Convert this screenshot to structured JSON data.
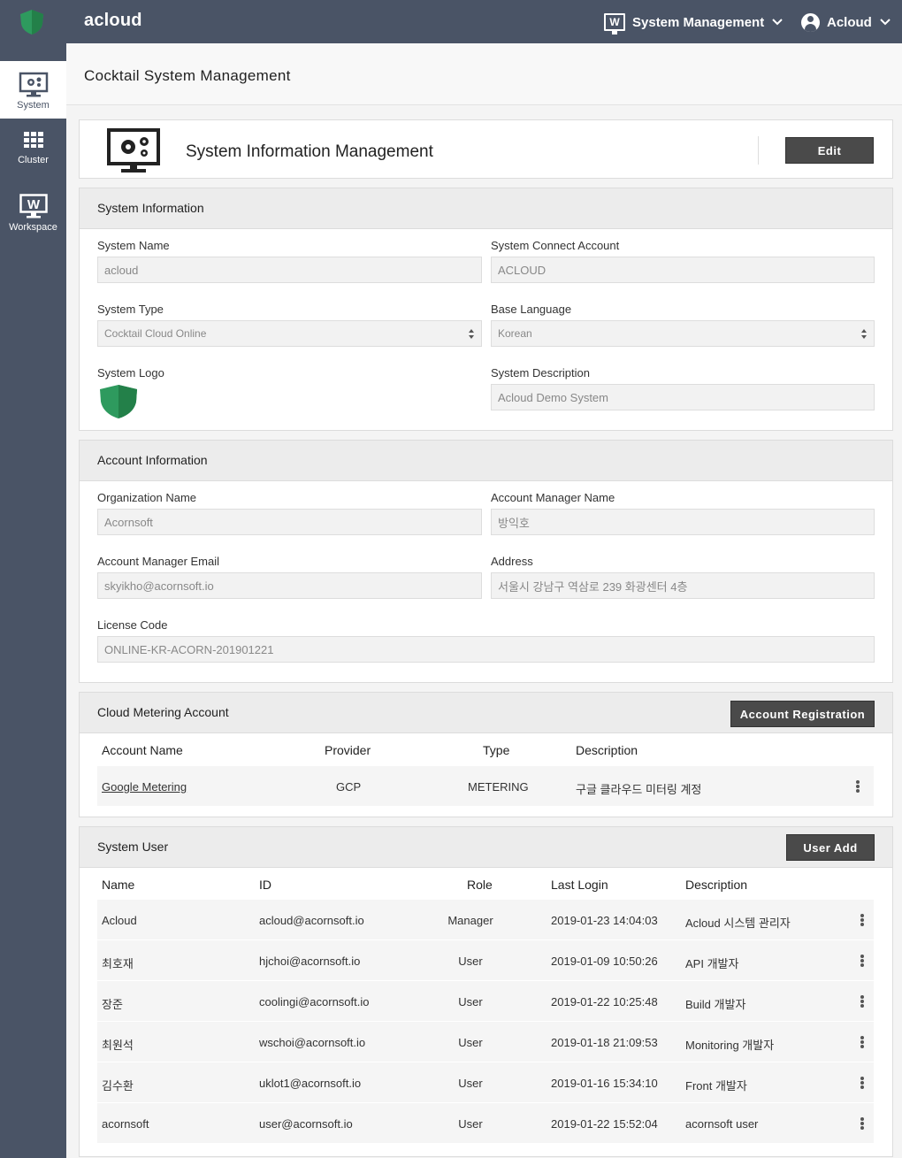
{
  "header": {
    "brand": "acloud",
    "system_menu": "System Management",
    "user_menu": "Acloud",
    "system_menu_icon": "workspace-w-icon",
    "brand_color": "#2e9a5e"
  },
  "sidebar": {
    "items": [
      {
        "label": "System",
        "icon": "monitor-gear-icon",
        "active": true
      },
      {
        "label": "Cluster",
        "icon": "grid-icon",
        "active": false
      },
      {
        "label": "Workspace",
        "icon": "workspace-w-icon",
        "active": false
      }
    ]
  },
  "page": {
    "title": "Cocktail System Management"
  },
  "info_card": {
    "title": "System Information Management",
    "edit_label": "Edit"
  },
  "system_info": {
    "title": "System Information",
    "system_name_label": "System Name",
    "system_name": "acloud",
    "connect_account_label": "System Connect Account",
    "connect_account": "ACLOUD",
    "system_type_label": "System Type",
    "system_type": "Cocktail Cloud Online",
    "base_language_label": "Base Language",
    "base_language": "Korean",
    "logo_label": "System Logo",
    "description_label": "System Description",
    "description": "Acloud Demo System"
  },
  "account_info": {
    "title": "Account Information",
    "org_label": "Organization Name",
    "org": "Acornsoft",
    "manager_label": "Account Manager Name",
    "manager": "방익호",
    "email_label": "Account Manager Email",
    "email": "skyikho@acornsoft.io",
    "address_label": "Address",
    "address": "서울시 강남구 역삼로 239 화광센터 4층",
    "license_label": "License Code",
    "license": "ONLINE-KR-ACORN-201901221"
  },
  "metering": {
    "title": "Cloud Metering Account",
    "register_label": "Account Registration",
    "columns": [
      "Account Name",
      "Provider",
      "Type",
      "Description"
    ],
    "rows": [
      {
        "name": "Google Metering",
        "provider": "GCP",
        "type": "METERING",
        "description": "구글 클라우드 미터링 계정"
      }
    ]
  },
  "users": {
    "title": "System User",
    "add_label": "User Add",
    "columns": [
      "Name",
      "ID",
      "Role",
      "Last Login",
      "Description"
    ],
    "rows": [
      {
        "name": "Acloud",
        "id": "acloud@acornsoft.io",
        "role": "Manager",
        "last_login": "2019-01-23 14:04:03",
        "description": "Acloud 시스템 관리자"
      },
      {
        "name": "최호재",
        "id": "hjchoi@acornsoft.io",
        "role": "User",
        "last_login": "2019-01-09 10:50:26",
        "description": "API 개발자"
      },
      {
        "name": "장준",
        "id": "coolingi@acornsoft.io",
        "role": "User",
        "last_login": "2019-01-22 10:25:48",
        "description": "Build 개발자"
      },
      {
        "name": "최원석",
        "id": "wschoi@acornsoft.io",
        "role": "User",
        "last_login": "2019-01-18 21:09:53",
        "description": "Monitoring 개발자"
      },
      {
        "name": "김수환",
        "id": "uklot1@acornsoft.io",
        "role": "User",
        "last_login": "2019-01-16 15:34:10",
        "description": "Front 개발자"
      },
      {
        "name": "acornsoft",
        "id": "user@acornsoft.io",
        "role": "User",
        "last_login": "2019-01-22 15:52:04",
        "description": "acornsoft user"
      }
    ]
  }
}
